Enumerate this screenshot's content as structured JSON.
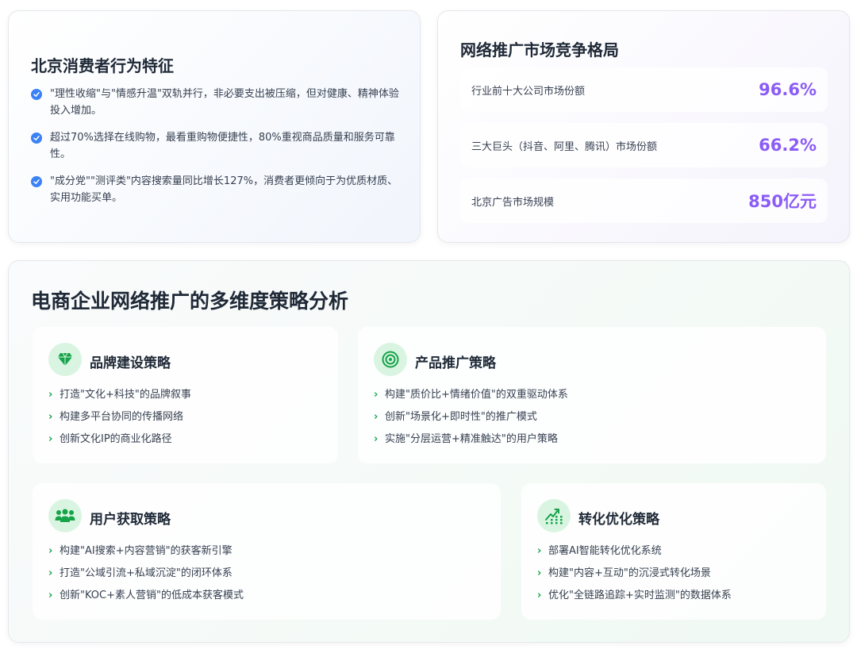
{
  "consumer": {
    "title": "北京消费者行为特征",
    "items": [
      "\"理性收缩\"与\"情感升温\"双轨并行，非必要支出被压缩，但对健康、精神体验投入增加。",
      "超过70%选择在线购物，最看重购物便捷性，80%重视商品质量和服务可靠性。",
      "\"成分党\"\"测评类\"内容搜索量同比增长127%，消费者更倾向于为优质材质、实用功能买单。"
    ]
  },
  "market": {
    "title": "网络推广市场竞争格局",
    "stats": [
      {
        "label": "行业前十大公司市场份额",
        "value": "96.6%"
      },
      {
        "label": "三大巨头（抖音、阿里、腾讯）市场份额",
        "value": "66.2%"
      },
      {
        "label": "北京广告市场规模",
        "value": "850亿元"
      }
    ]
  },
  "strategy": {
    "title": "电商企业网络推广的多维度策略分析",
    "brand": {
      "title": "品牌建设策略",
      "icon": "diamond-icon",
      "items": [
        "打造\"文化+科技\"的品牌叙事",
        "构建多平台协同的传播网络",
        "创新文化IP的商业化路径"
      ]
    },
    "product": {
      "title": "产品推广策略",
      "icon": "target-icon",
      "items": [
        "构建\"质价比+情绪价值\"的双重驱动体系",
        "创新\"场景化+即时性\"的推广模式",
        "实施\"分层运营+精准触达\"的用户策略"
      ]
    },
    "user": {
      "title": "用户获取策略",
      "icon": "users-icon",
      "items": [
        "构建\"AI搜索+内容营销\"的获客新引擎",
        "打造\"公域引流+私域沉淀\"的闭环体系",
        "创新\"KOC+素人营销\"的低成本获客模式"
      ]
    },
    "convert": {
      "title": "转化优化策略",
      "icon": "growth-chart-icon",
      "items": [
        "部署AI智能转化优化系统",
        "构建\"内容+互动\"的沉浸式转化场景",
        "优化\"全链路追踪+实时监测\"的数据体系"
      ]
    }
  },
  "colors": {
    "check": "#3b82f6",
    "stat_value": "#8b5cf6",
    "accent_green": "#16a34a",
    "icon_bg": "#d9f5e1"
  }
}
